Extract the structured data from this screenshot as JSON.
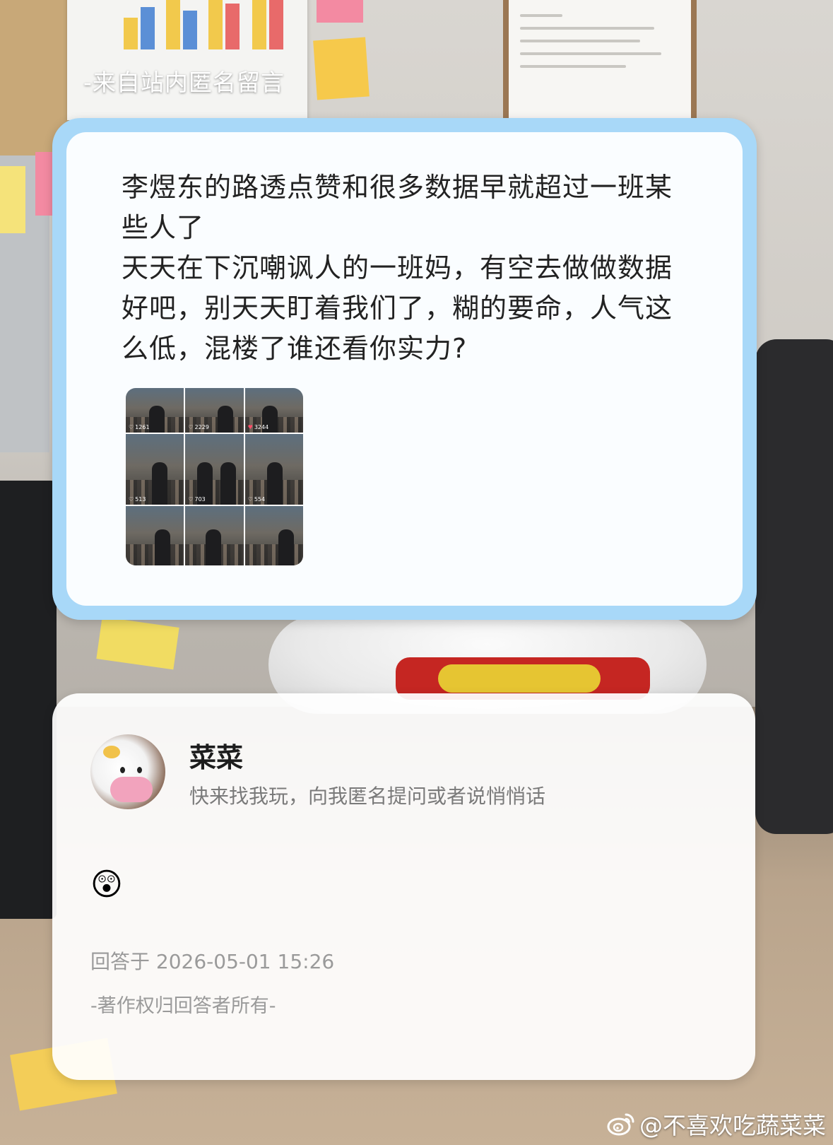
{
  "source_caption": "-来自站内匿名留言",
  "question": {
    "lines": [
      "李煜东的路透点赞和很多数据早就超过一班某",
      "些人了",
      "天天在下沉嘲讽人的一班妈，有空去做做数据",
      "好吧，别天天盯着我们了，糊的要命，人气这",
      "么低，混楼了谁还看你实力?"
    ],
    "photo_grid": {
      "likes": [
        "1261",
        "2229",
        "3244",
        "513",
        "703",
        "554"
      ]
    }
  },
  "answer": {
    "name": "菜菜",
    "bio": "快来找我玩，向我匿名提问或者说悄悄话",
    "emoji": "😲",
    "time": "回答于 2026-05-01 15:26",
    "copyright": "-著作权归回答者所有-"
  },
  "watermark": {
    "icon": "weibo-icon",
    "text": "@不喜欢吃蔬菜菜"
  },
  "colors": {
    "card_border": "#a8d8f8",
    "text_primary": "#222222",
    "text_secondary": "#7a7a7a",
    "text_muted": "#9a9a9a"
  }
}
